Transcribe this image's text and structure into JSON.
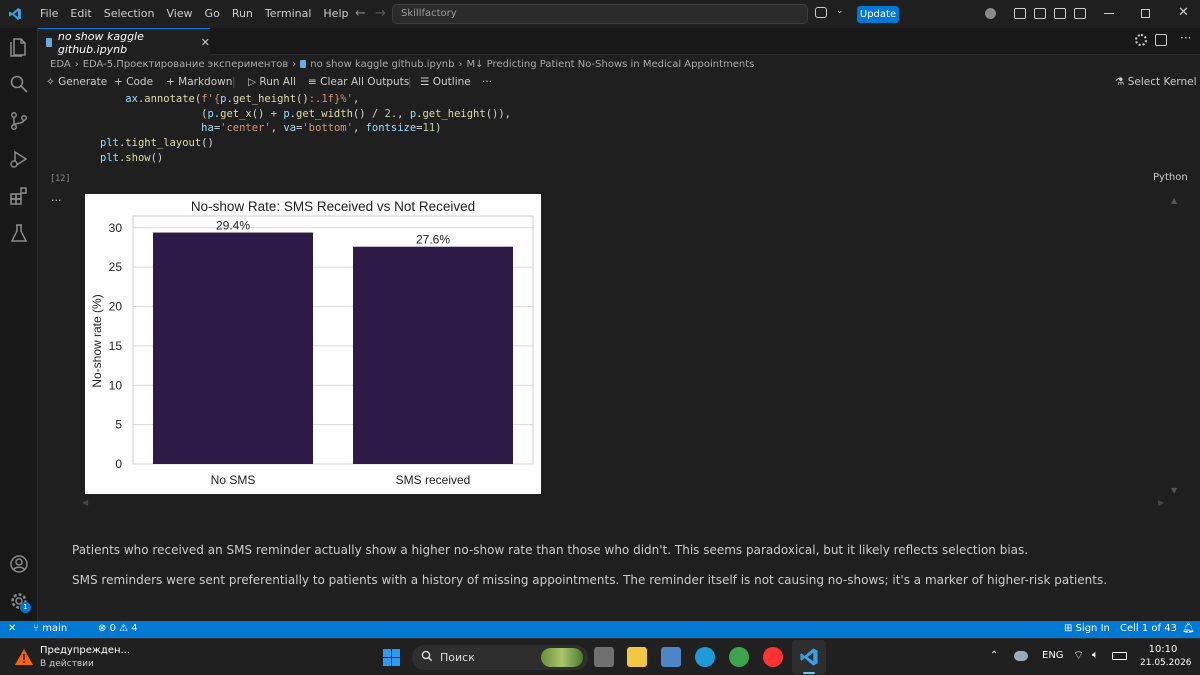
{
  "menu": [
    "File",
    "Edit",
    "Selection",
    "View",
    "Go",
    "Run",
    "Terminal",
    "Help"
  ],
  "search_text": "Skillfactory",
  "update_label": "Update",
  "tab": {
    "title": "no show kaggle github.ipynb",
    "close": "✕"
  },
  "breadcrumb": [
    "EDA",
    "EDA-5.Проектирование экспериментов",
    "no show kaggle github.ipynb",
    "M↓ Predicting Patient No-Shows in Medical Appointments"
  ],
  "toolbar": {
    "generate": "Generate",
    "code": "Code",
    "markdown": "Markdown",
    "run_all": "Run All",
    "clear": "Clear All Outputs",
    "outline": "Outline",
    "more": "···",
    "kernel": "Select Kernel"
  },
  "cell": {
    "exec_count": "[12]",
    "language": "Python",
    "output_dots": "···"
  },
  "chart_data": {
    "type": "bar",
    "title": "No-show Rate: SMS Received vs Not Received",
    "ylabel": "No-show rate (%)",
    "xlabel": "",
    "categories": [
      "No SMS",
      "SMS received"
    ],
    "values": [
      29.4,
      27.6
    ],
    "data_labels": [
      "29.4%",
      "27.6%"
    ],
    "yticks": [
      0,
      5,
      10,
      15,
      20,
      25,
      30
    ],
    "ylim": [
      0,
      31.5
    ],
    "bar_color": "#2e1a47",
    "grid": true
  },
  "markdown": {
    "p1": "Patients who received an SMS reminder actually show a higher no-show rate than those who didn't. This seems paradoxical, but it likely reflects selection bias.",
    "p2": "SMS reminders were sent preferentially to patients with a history of missing appointments. The reminder itself is not causing no-shows; it's a marker of higher-risk patients."
  },
  "status": {
    "branch": "main",
    "errors": "0",
    "warnings": "4",
    "sign_in": "Sign In",
    "cell_pos": "Cell 1 of 43"
  },
  "taskbar": {
    "warning_title": "Предупрежден...",
    "warning_sub": "В действии",
    "search": "Поиск",
    "lang": "ENG",
    "time": "10:10",
    "date": "21.05.2026"
  },
  "colors": {
    "accent": "#0078d4",
    "bar": "#2e1a47"
  }
}
